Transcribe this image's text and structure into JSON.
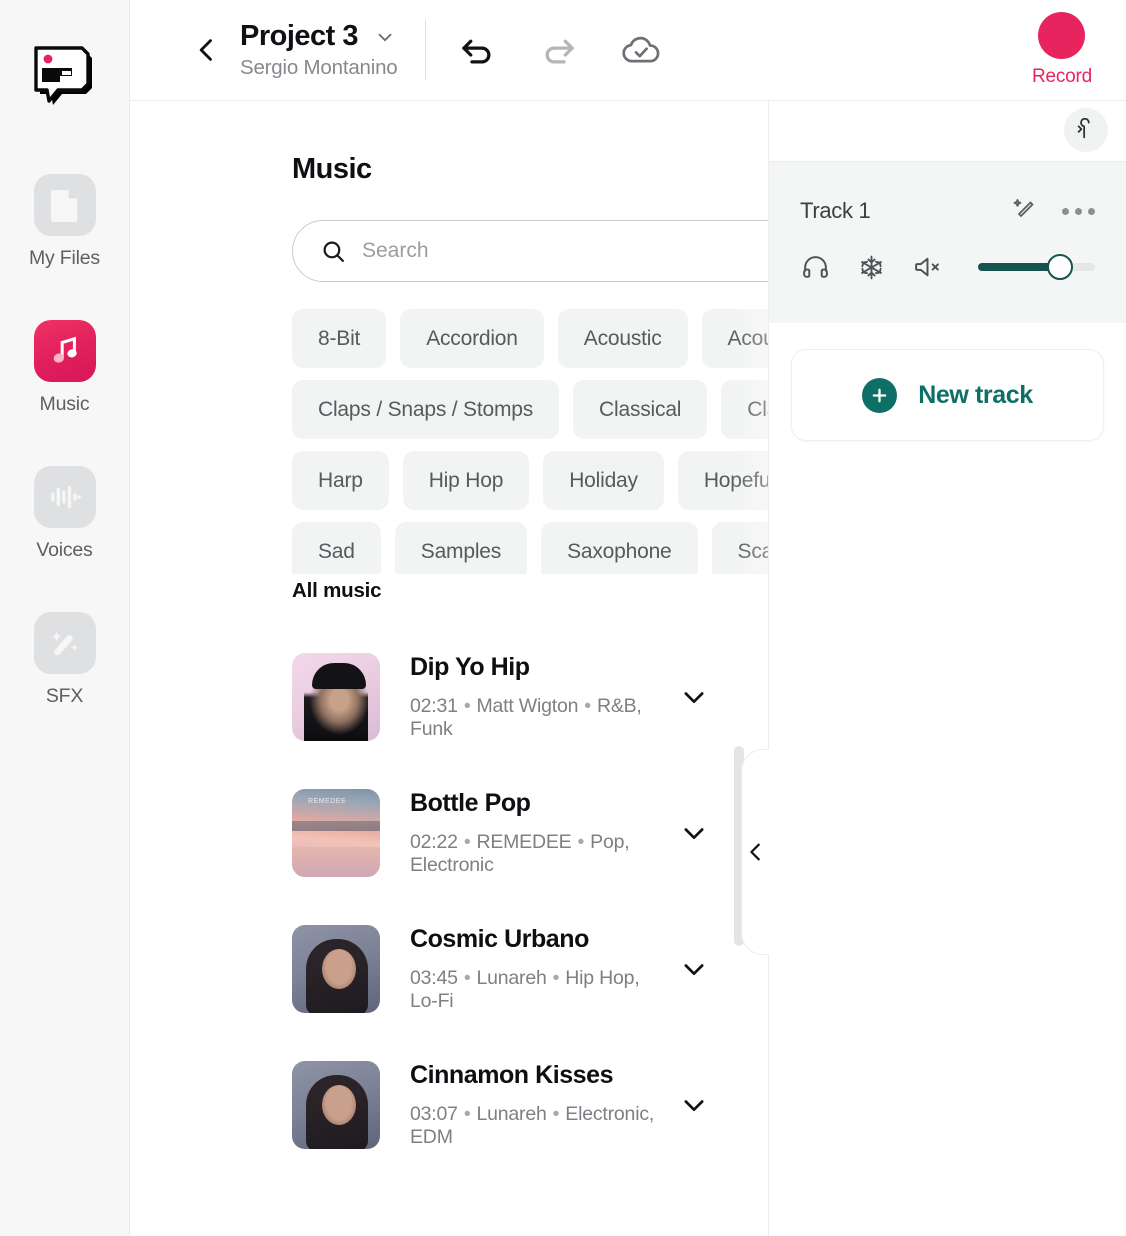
{
  "sidebar": {
    "logo_icon": "speech-bubble-logo",
    "items": [
      {
        "label": "My Files",
        "icon": "document-icon",
        "active": false
      },
      {
        "label": "Music",
        "icon": "music-note-icon",
        "active": true
      },
      {
        "label": "Voices",
        "icon": "waveform-icon",
        "active": false
      },
      {
        "label": "SFX",
        "icon": "magic-wand-icon",
        "active": false
      }
    ]
  },
  "topbar": {
    "back_icon": "chevron-left-icon",
    "project_title": "Project 3",
    "project_dropdown_icon": "chevron-down-icon",
    "project_owner": "Sergio Montanino",
    "undo_icon": "undo-icon",
    "redo_icon": "redo-icon",
    "cloud_icon": "cloud-check-icon",
    "record_label": "Record",
    "record_color": "#e8245e"
  },
  "library": {
    "title": "Music",
    "search": {
      "placeholder": "Search",
      "value": "",
      "icon": "search-icon"
    },
    "tag_rows": [
      [
        "8-Bit",
        "Accordion",
        "Acoustic",
        "Acoustic Guitar"
      ],
      [
        "Claps / Snaps / Stomps",
        "Classical",
        "Classic Rock"
      ],
      [
        "Harp",
        "Hip Hop",
        "Holiday",
        "Hopeful"
      ],
      [
        "Sad",
        "Samples",
        "Saxophone",
        "Scary"
      ]
    ],
    "tags_next_icon": "chevron-right-icon",
    "list_heading": "All music",
    "tracks": [
      {
        "name": "Dip Yo Hip",
        "duration": "02:31",
        "artist": "Matt Wigton",
        "genres": "R&B, Funk",
        "expand_icon": "chevron-down-icon",
        "art": "art1",
        "art_label": ""
      },
      {
        "name": "Bottle Pop",
        "duration": "02:22",
        "artist": "REMEDEE",
        "genres": "Pop, Electronic",
        "expand_icon": "chevron-down-icon",
        "art": "art2",
        "art_label": "REMEDEE"
      },
      {
        "name": "Cosmic Urbano",
        "duration": "03:45",
        "artist": "Lunareh",
        "genres": "Hip Hop, Lo-Fi",
        "expand_icon": "chevron-down-icon",
        "art": "art3",
        "art_label": ""
      },
      {
        "name": "Cinnamon Kisses",
        "duration": "03:07",
        "artist": "Lunareh",
        "genres": "Electronic, EDM",
        "expand_icon": "chevron-down-icon",
        "art": "art4",
        "art_label": ""
      }
    ],
    "separator": "•"
  },
  "splitter": {
    "collapse_icon": "chevron-left-icon"
  },
  "right_panel": {
    "pin_icon": "pin-marker-icon",
    "track": {
      "name": "Track 1",
      "magic_icon": "magic-wand-icon",
      "more_icon": "more-options-icon",
      "headphones_icon": "headphones-icon",
      "freeze_icon": "snowflake-icon",
      "mute_icon": "speaker-mute-icon",
      "volume_percent": 70,
      "accent_color": "#15544e"
    },
    "new_track_label": "New track",
    "new_track_icon": "plus-circle-icon",
    "new_track_color": "#0e6f66"
  }
}
